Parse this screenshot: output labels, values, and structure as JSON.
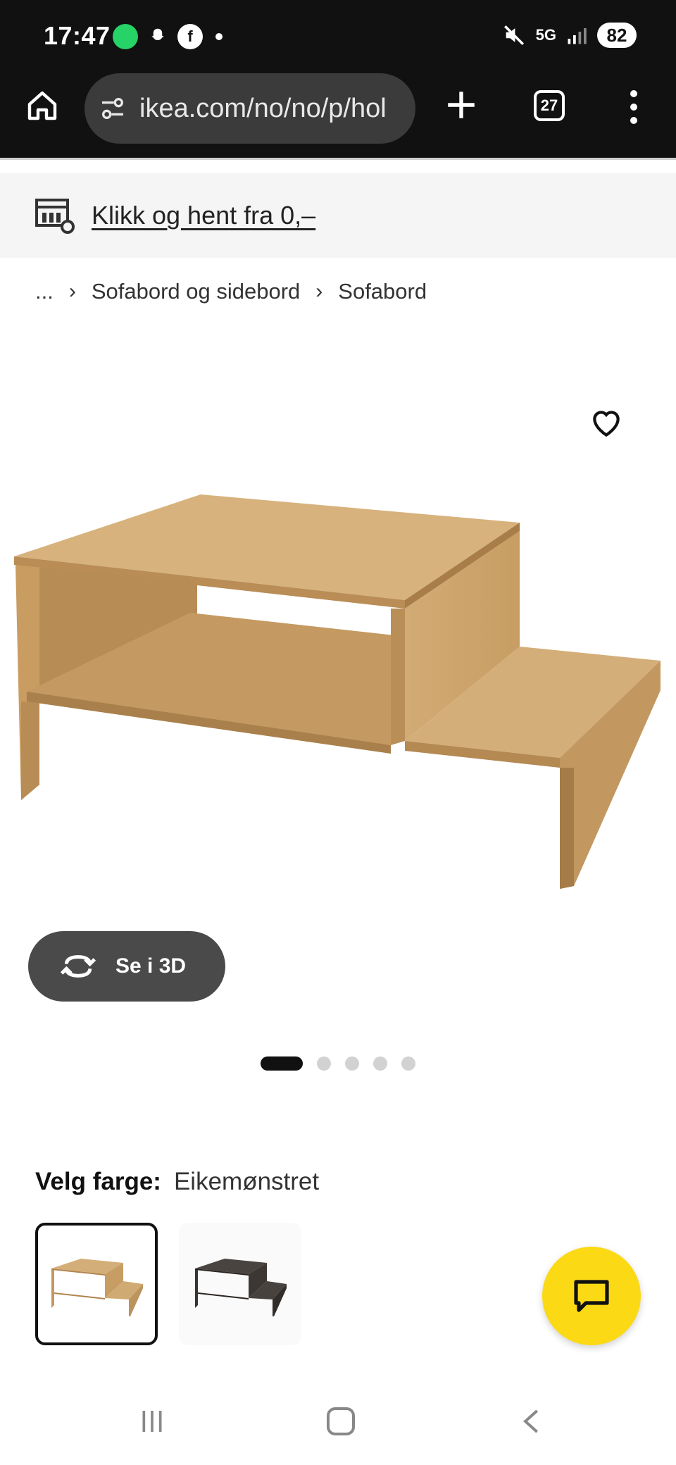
{
  "status_bar": {
    "time": "17:47",
    "network": "5G",
    "battery": "82",
    "icons": [
      "whatsapp-business-icon",
      "snapchat-icon",
      "facebook-icon",
      "mute-icon",
      "signal-icon"
    ]
  },
  "browser": {
    "url": "ikea.com/no/no/p/hol",
    "tab_count": "27"
  },
  "promo": {
    "text": "Klikk og hent fra 0,–"
  },
  "breadcrumb": {
    "ellipsis": "...",
    "items": [
      "Sofabord og sidebord",
      "Sofabord"
    ]
  },
  "product": {
    "view_3d_label": "Se i 3D",
    "image_count": 5,
    "active_image_index": 0
  },
  "color_selector": {
    "label": "Velg farge:",
    "value": "Eikemønstret",
    "options": [
      {
        "name": "oak",
        "color": "#c9a26b",
        "selected": true
      },
      {
        "name": "black-brown",
        "color": "#3a3430",
        "selected": false
      }
    ]
  },
  "colors": {
    "chat_fab": "#fbd914",
    "dark": "#111111"
  }
}
